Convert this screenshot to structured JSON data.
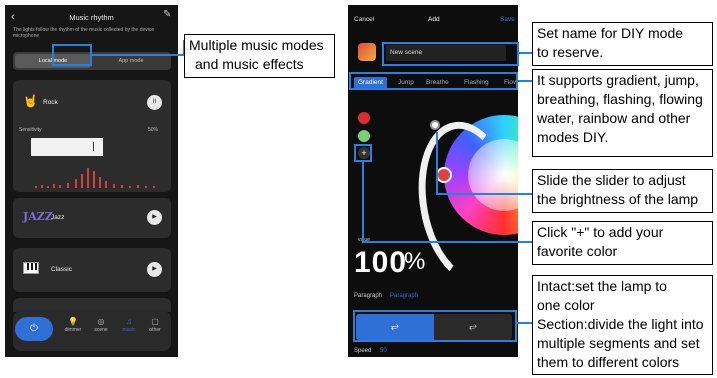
{
  "left_phone": {
    "back": "‹",
    "title": "Music rhythm",
    "edit": "✎",
    "description": "The lights follow the rhythm of the music collected by the device microphone",
    "tabs": [
      "Local mode",
      "App mode"
    ],
    "cards": [
      {
        "label": "Rock",
        "icon": "hand-icon",
        "control": "II",
        "sensitivity_label": "Sensitivity",
        "sensitivity_value": "50%"
      },
      {
        "label": "Jazz",
        "icon": "jazz-logo",
        "logo_text": "JAZZ",
        "control": "▶"
      },
      {
        "label": "Classic",
        "icon": "piano-icon",
        "control": "▶"
      }
    ],
    "nav": [
      {
        "label": "dimmer",
        "icon": "bulb-icon"
      },
      {
        "label": "scene",
        "icon": "scene-icon"
      },
      {
        "label": "music",
        "icon": "music-icon",
        "active": true
      },
      {
        "label": "other",
        "icon": "other-icon"
      }
    ],
    "accent": "#2f6fd6"
  },
  "right_phone": {
    "cancel": "Cancel",
    "title": "Add",
    "save": "Save",
    "scene_name": "New scene",
    "tabs": [
      "Gradient",
      "Jump",
      "Breathe",
      "Flashing",
      "Flow"
    ],
    "add": "+",
    "value_label": "value",
    "brightness": "100",
    "percent": "%",
    "paragraph_label": "Paragraph",
    "paragraph_value": "Paragraph",
    "speed_label": "Speed",
    "speed_value": "50"
  },
  "callouts": {
    "music_modes": [
      "Multiple music modes",
      "and music effects"
    ],
    "set_name": [
      "Set name for DIY mode",
      "to reserve."
    ],
    "modes_diy": [
      "It supports gradient, jump,",
      "breathing, flashing, flowing",
      "water, rainbow and other",
      "modes DIY."
    ],
    "slider": [
      "Slide the slider to adjust",
      "the brightness of the lamp"
    ],
    "add_color": [
      "Click \"+\" to add your",
      "favorite color"
    ],
    "intact": [
      "Intact:set the lamp to",
      "one color",
      "Section:divide the light into",
      "multiple segments and set",
      "them to different colors"
    ]
  }
}
